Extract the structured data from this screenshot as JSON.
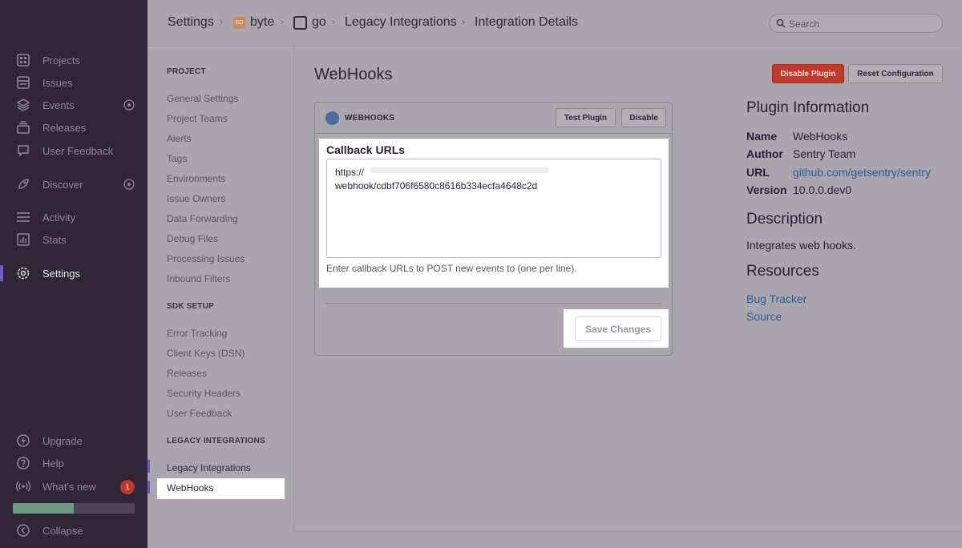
{
  "sidebar": {
    "items": [
      {
        "label": "Projects",
        "icon": "projects-icon"
      },
      {
        "label": "Issues",
        "icon": "issues-icon"
      },
      {
        "label": "Events",
        "icon": "events-icon"
      },
      {
        "label": "Releases",
        "icon": "releases-icon"
      },
      {
        "label": "User Feedback",
        "icon": "user-feedback-icon"
      },
      {
        "label": "Discover",
        "icon": "discover-icon"
      },
      {
        "label": "Activity",
        "icon": "activity-icon"
      },
      {
        "label": "Stats",
        "icon": "stats-icon"
      },
      {
        "label": "Settings",
        "icon": "settings-icon"
      }
    ],
    "bottom": [
      {
        "label": "Upgrade",
        "icon": "lightning-icon"
      },
      {
        "label": "Help",
        "icon": "help-icon"
      },
      {
        "label": "What's new",
        "icon": "broadcast-icon"
      },
      {
        "label": "Collapse",
        "icon": "collapse-icon"
      }
    ],
    "whats_new_count": "1",
    "progress_fraction": 0.5
  },
  "breadcrumb": {
    "settings": "Settings",
    "org": "byte",
    "org_initials": "BO",
    "project": "go",
    "legacy": "Legacy Integrations",
    "details": "Integration Details"
  },
  "search": {
    "placeholder": "Search"
  },
  "subnav": {
    "project_heading": "PROJECT",
    "project_items": [
      "General Settings",
      "Project Teams",
      "Alerts",
      "Tags",
      "Environments",
      "Issue Owners",
      "Data Forwarding",
      "Debug Files",
      "Processing Issues",
      "Inbound Filters"
    ],
    "sdk_heading": "SDK SETUP",
    "sdk_items": [
      "Error Tracking",
      "Client Keys (DSN)",
      "Releases",
      "Security Headers",
      "User Feedback"
    ],
    "legacy_heading": "LEGACY INTEGRATIONS",
    "legacy_items": [
      "Legacy Integrations",
      "WebHooks"
    ]
  },
  "main": {
    "title": "WebHooks",
    "disable_plugin": "Disable Plugin",
    "reset_config": "Reset Configuration",
    "panel": {
      "title": "WEBHOOKS",
      "test_plugin": "Test Plugin",
      "disable": "Disable",
      "field_label": "Callback URLs",
      "field_value": "https://\nwebhook/cdbf706f6580c8616b334ecfa4648c2d",
      "help": "Enter callback URLs to POST new events to (one per line).",
      "save": "Save Changes"
    }
  },
  "info": {
    "heading": "Plugin Information",
    "name_k": "Name",
    "name_v": "WebHooks",
    "author_k": "Author",
    "author_v": "Sentry Team",
    "url_k": "URL",
    "url_v": "github.com/getsentry/sentry",
    "version_k": "Version",
    "version_v": "10.0.0.dev0",
    "desc_heading": "Description",
    "desc": "Integrates web hooks.",
    "resources_heading": "Resources",
    "resources": [
      "Bug Tracker",
      "Source"
    ]
  }
}
